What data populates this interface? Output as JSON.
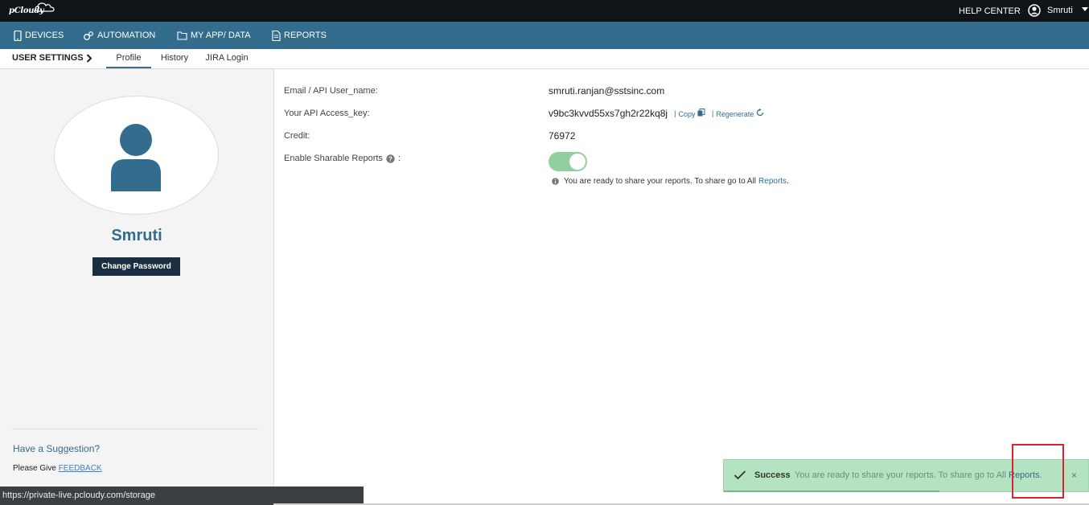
{
  "topbar": {
    "logo_text": "pCloudy",
    "help_center": "HELP CENTER",
    "user_name": "Smruti"
  },
  "nav": {
    "items": [
      {
        "label": "DEVICES",
        "icon": "phone-icon"
      },
      {
        "label": "AUTOMATION",
        "icon": "gears-icon"
      },
      {
        "label": "MY APP/ DATA",
        "icon": "folder-icon"
      },
      {
        "label": "REPORTS",
        "icon": "document-icon"
      }
    ]
  },
  "subnav": {
    "section": "USER SETTINGS",
    "tabs": [
      {
        "label": "Profile",
        "active": true
      },
      {
        "label": "History",
        "active": false
      },
      {
        "label": "JIRA Login",
        "active": false
      }
    ]
  },
  "sidebar": {
    "name": "Smruti",
    "change_password": "Change Password",
    "suggestion": "Have a Suggestion?",
    "please_give": "Please Give",
    "feedback": "FEEDBACK"
  },
  "profile": {
    "email_label": "Email / API User_name:",
    "email_value": "smruti.ranjan@sstsinc.com",
    "api_label": "Your API Access_key:",
    "api_value": "v9bc3kvvd55xs7gh2r22kq8j",
    "copy_label": "Copy",
    "regenerate_label": "Regenerate",
    "credit_label": "Credit:",
    "credit_value": "76972",
    "sharable_label": "Enable Sharable Reports",
    "sharable_colon": ":",
    "sharable_enabled": true,
    "share_note": "You are ready to share your reports. To share go to All",
    "share_note_link": "Reports",
    "share_note_end": "."
  },
  "toast": {
    "title": "Success",
    "message": "You are ready to share your reports. To share go to All",
    "link": "Reports",
    "end": ".",
    "close": "×"
  },
  "statusbar": {
    "url": "https://private-live.pcloudy.com/storage"
  },
  "colors": {
    "topbar": "#0f1418",
    "navbar": "#336c8c",
    "toggle_on": "#92cfa0",
    "toast_bg": "#b4e3c2",
    "highlight": "#d9232e"
  }
}
